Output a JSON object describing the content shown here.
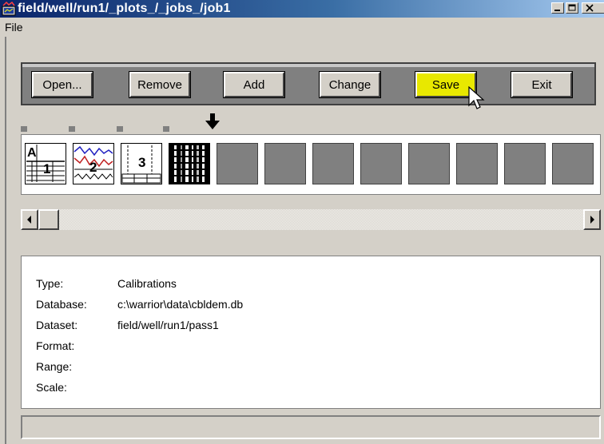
{
  "window": {
    "title": "field/well/run1/_plots_/_jobs_/job1"
  },
  "menu": {
    "items": [
      {
        "label": "File"
      }
    ]
  },
  "toolbar": {
    "buttons": [
      {
        "label": "Open..."
      },
      {
        "label": "Remove"
      },
      {
        "label": "Add"
      },
      {
        "label": "Change"
      },
      {
        "label": "Save",
        "highlight_color": "#e8e800"
      },
      {
        "label": "Exit"
      }
    ]
  },
  "thumbnails": {
    "selected_index": 3,
    "items": [
      {
        "label": "1",
        "icon": "table-plot-icon"
      },
      {
        "label": "2",
        "icon": "curve-plot-icon"
      },
      {
        "label": "3",
        "icon": "track-plot-icon"
      },
      {
        "label": "",
        "icon": "image-log-icon"
      }
    ],
    "empty_slots": 8
  },
  "info": {
    "rows": [
      {
        "label": "Type:",
        "value": "Calibrations"
      },
      {
        "label": "Database:",
        "value": "c:\\warrior\\data\\cbldem.db"
      },
      {
        "label": "Dataset:",
        "value": "field/well/run1/pass1"
      },
      {
        "label": "Format:",
        "value": ""
      },
      {
        "label": "Range:",
        "value": ""
      },
      {
        "label": "Scale:",
        "value": ""
      }
    ]
  }
}
